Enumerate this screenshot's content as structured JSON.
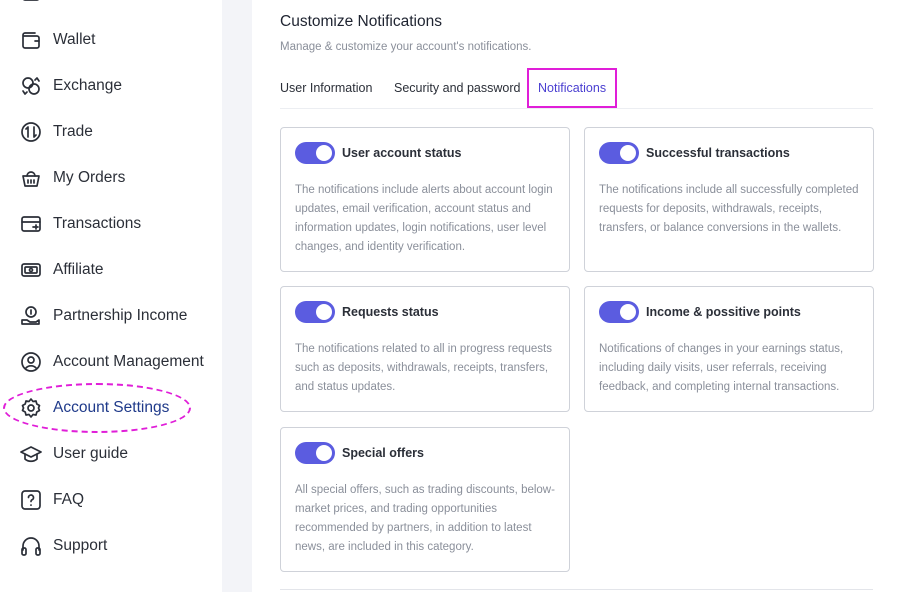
{
  "sidebar": {
    "items": [
      {
        "label": "Wallet",
        "icon": "wallet-icon"
      },
      {
        "label": "Exchange",
        "icon": "exchange-icon"
      },
      {
        "label": "Trade",
        "icon": "trade-icon"
      },
      {
        "label": "My Orders",
        "icon": "orders-icon"
      },
      {
        "label": "Transactions",
        "icon": "transactions-icon"
      },
      {
        "label": "Affiliate",
        "icon": "affiliate-icon"
      },
      {
        "label": "Partnership Income",
        "icon": "partnership-icon"
      },
      {
        "label": "Account Management",
        "icon": "user-circle-icon"
      },
      {
        "label": "Account Settings",
        "icon": "gear-icon",
        "active": true
      },
      {
        "label": "User guide",
        "icon": "graduation-cap-icon"
      },
      {
        "label": "FAQ",
        "icon": "question-icon"
      },
      {
        "label": "Support",
        "icon": "headphones-icon"
      }
    ]
  },
  "main": {
    "title": "Customize Notifications",
    "subtitle": "Manage & customize your account's notifications.",
    "tabs": [
      {
        "label": "User Information"
      },
      {
        "label": "Security and password"
      },
      {
        "label": "Notifications",
        "active": true
      }
    ],
    "cards": [
      {
        "title": "User account status",
        "enabled": true,
        "description": "The notifications include alerts about account login updates, email verification, account status and information updates, login notifications, user level changes, and identity verification."
      },
      {
        "title": "Successful transactions",
        "enabled": true,
        "description": "The notifications include all successfully completed requests for deposits, withdrawals, receipts, transfers, or balance conversions in the wallets."
      },
      {
        "title": "Requests status",
        "enabled": true,
        "description": "The notifications related to all in progress requests such as deposits, withdrawals, receipts, transfers, and status updates."
      },
      {
        "title": "Income & possitive points",
        "enabled": true,
        "description": "Notifications of changes in your earnings status, including daily visits, user referrals, receiving feedback, and completing internal transactions."
      },
      {
        "title": "Special offers",
        "enabled": true,
        "description": "All special offers, such as trading discounts, below-market prices, and trading opportunities recommended by partners, in addition to latest news, are included in this category."
      }
    ]
  },
  "colors": {
    "accent": "#5b5ce0",
    "active_tab_text": "#4a3fd1",
    "highlight": "#e01ed8",
    "active_nav_text": "#1f3a8a"
  }
}
